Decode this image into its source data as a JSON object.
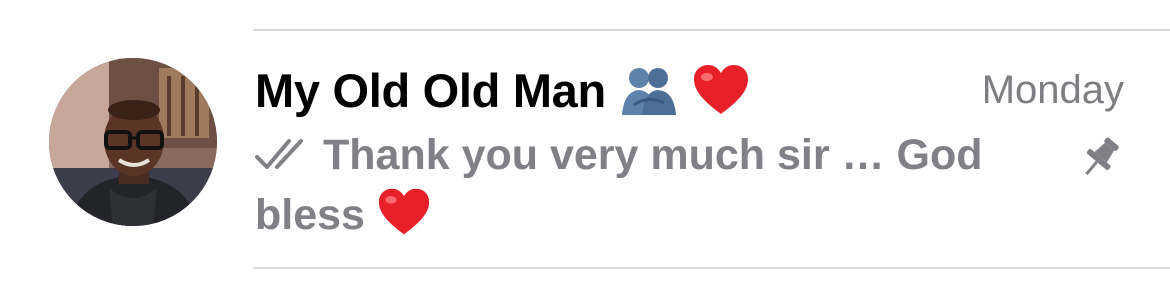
{
  "chat": {
    "title": "My Old Old Man",
    "title_emojis": [
      "people-hugging-icon",
      "red-heart-icon"
    ],
    "timestamp": "Monday",
    "preview_text": "Thank you very much sir … God bless",
    "preview_emoji": "red-heart-icon",
    "status_icon": "double-check-icon",
    "pinned_icon": "pin-icon"
  },
  "colors": {
    "title": "#000000",
    "secondary": "#7d7d82",
    "divider": "#d9d9dc",
    "heart": "#e8202a",
    "hug": "#5b7fa8"
  }
}
